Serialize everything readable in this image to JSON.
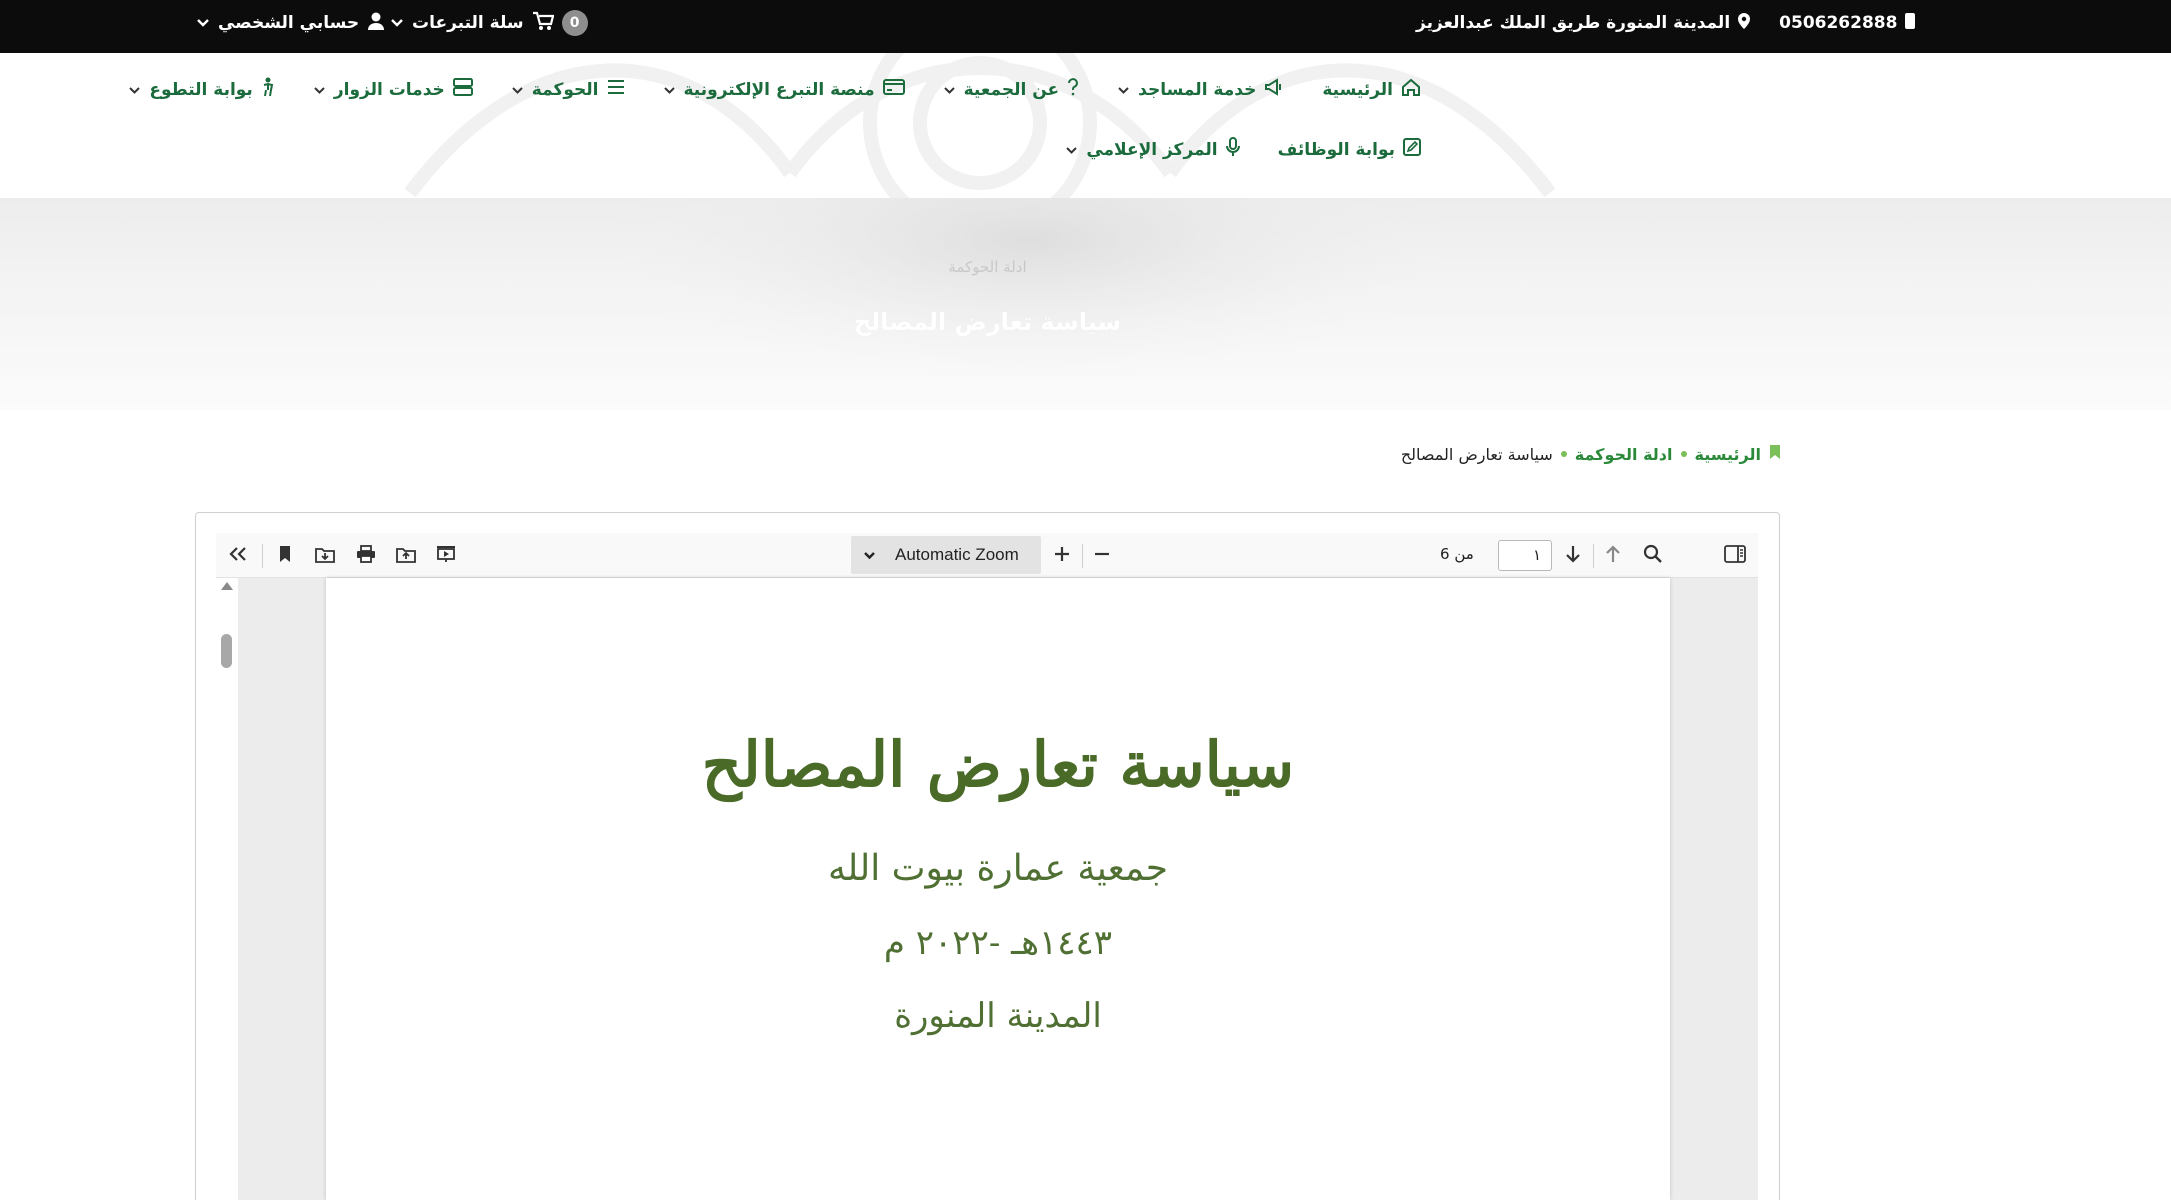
{
  "topbar": {
    "phone": "0506262888",
    "address": "المدينة المنورة طريق الملك عبدالعزيز",
    "cart_label": "سلة التبرعات",
    "cart_count": "0",
    "account_label": "حسابي الشخصي"
  },
  "nav": {
    "row1": [
      {
        "label": "الرئيسية",
        "icon": "home-icon",
        "has_caret": false
      },
      {
        "label": "خدمة المساجد",
        "icon": "megaphone-icon",
        "has_caret": true
      },
      {
        "label": "عن الجمعية",
        "icon": "question-icon",
        "has_caret": true
      },
      {
        "label": "منصة التبرع الإلكترونية",
        "icon": "credit-card-icon",
        "has_caret": true
      },
      {
        "label": "الحوكمة",
        "icon": "list-icon",
        "has_caret": true
      },
      {
        "label": "خدمات الزوار",
        "icon": "server-icon",
        "has_caret": true
      },
      {
        "label": "بوابة التطوع",
        "icon": "person-icon",
        "has_caret": true
      }
    ],
    "row2": [
      {
        "label": "بوابة الوظائف",
        "icon": "edit-icon",
        "has_caret": false
      },
      {
        "label": "المركز الإعلامي",
        "icon": "microphone-icon",
        "has_caret": true
      }
    ]
  },
  "hero": {
    "subtitle": "ادلة الحوكمة",
    "title": "سياسة تعارض المصالح"
  },
  "breadcrumb": {
    "home": "الرئيسية",
    "parent": "ادلة الحوكمة",
    "current": "سياسة تعارض المصالح"
  },
  "pdf_viewer": {
    "zoom": "Automatic Zoom",
    "page_number": "١",
    "page_count": "من 6",
    "page_content": {
      "title": "سياسة تعارض المصالح",
      "org": "جمعية عمارة بيوت الله",
      "date": "١٤٤٣هـ -٢٠٢٢ م",
      "city": "المدينة المنورة"
    }
  },
  "colors": {
    "brand_green": "#1b6b3c",
    "breadcrumb_green": "#2a8a3a",
    "topbar_bg": "#0c0c0c"
  }
}
